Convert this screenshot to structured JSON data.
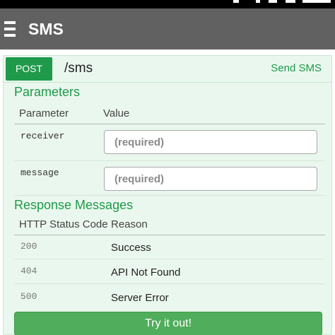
{
  "app_bar": {
    "title": "SMS",
    "color": "#616161"
  },
  "operation": {
    "method": "POST",
    "path": "/sms",
    "summary": "Send SMS",
    "accent_color": "#1e9a4a",
    "panel_color": "#eaf7ee"
  },
  "parameters": {
    "title": "Parameters",
    "columns": [
      "Parameter",
      "Value"
    ],
    "rows": [
      {
        "name": "receiver",
        "value": "",
        "placeholder": "(required)"
      },
      {
        "name": "message",
        "value": "",
        "placeholder": "(required)"
      }
    ]
  },
  "responses": {
    "title": "Response Messages",
    "columns": [
      "HTTP Status Code",
      "Reason"
    ],
    "rows": [
      {
        "code": "200",
        "reason": "Success"
      },
      {
        "code": "404",
        "reason": "API Not Found"
      },
      {
        "code": "500",
        "reason": "Server Error"
      }
    ]
  },
  "try_button": {
    "label": "Try it out!",
    "color": "#4fad5b"
  },
  "icons": [
    "menu-icon"
  ]
}
